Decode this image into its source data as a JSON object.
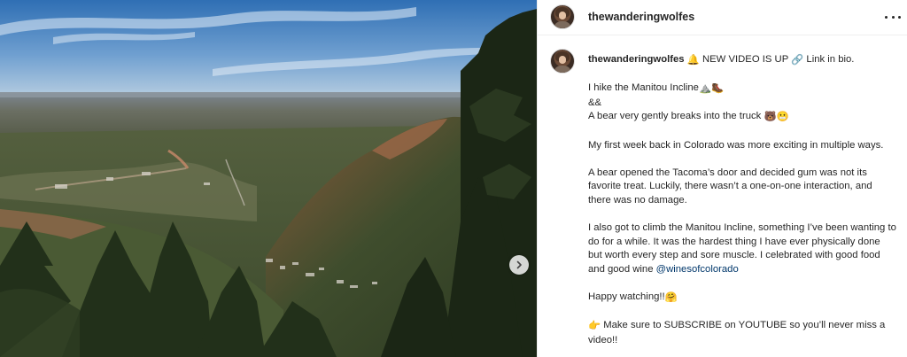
{
  "post": {
    "username": "thewanderingwolfes",
    "caption": {
      "line1": "NEW VIDEO IS UP",
      "line1_tail": "Link in bio.",
      "p1_line1": "I hike the Manitou Incline",
      "p1_line2": "&&",
      "p1_line3": "A bear very gently breaks into the truck",
      "p2": "My first week back in Colorado was more exciting in multiple ways.",
      "p3": "A bear opened the Tacoma’s door and decided gum was not its favorite treat. Luckily, there wasn’t a one-on-one interaction, and there was no damage.",
      "p4": "I also got to climb the Manitou Incline, something I’ve been wanting to do for a while. It was the hardest thing I have ever physically done but worth every step and sore muscle. I celebrated with good food and good wine",
      "p4_mention": "@winesofcolorado",
      "p5": "Happy watching!!",
      "p6": "Make sure to SUBSCRIBE on YOUTUBE so you’ll never miss a video!!"
    }
  },
  "icons": {
    "bell": "bell-icon",
    "link": "link-icon",
    "mountain": "mountain-icon",
    "boot": "hiking-boot-icon",
    "bear": "bear-icon",
    "grin": "grimace-emoji-icon",
    "hug": "smile-emoji-icon",
    "point": "pointing-hand-icon",
    "more": "more-options-icon",
    "next": "chevron-right-icon"
  },
  "colors": {
    "text": "#262626",
    "mention": "#00376b",
    "divider": "#efefef"
  }
}
